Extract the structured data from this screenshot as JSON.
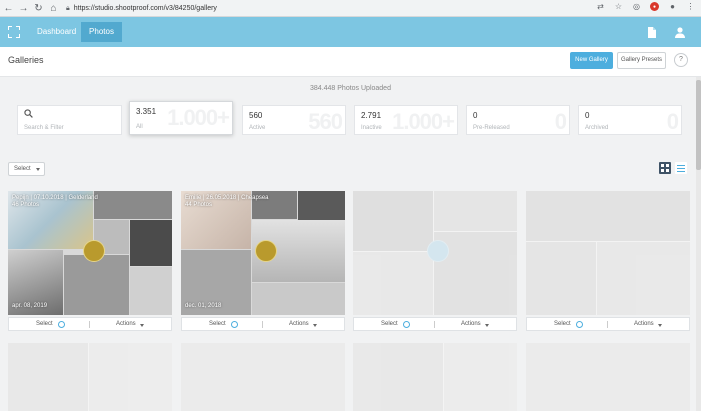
{
  "browser": {
    "url": "https://studio.shootproof.com/v3/84250/gallery",
    "icons": [
      "back-icon",
      "forward-icon",
      "reload-icon",
      "home-icon",
      "lock-icon"
    ]
  },
  "header": {
    "tabs": [
      {
        "label": "Dashboard",
        "active": false
      },
      {
        "label": "Photos",
        "active": true
      }
    ],
    "brand_color": "#7dc6e2",
    "active_tab_color": "#52a9cf"
  },
  "toolbar": {
    "title": "Galleries",
    "new_gallery_label": "New Gallery",
    "gallery_presets_label": "Gallery Presets",
    "help_label": "?"
  },
  "summary": {
    "text": "384.448 Photos Uploaded"
  },
  "stats": {
    "search": {
      "label": "Search & Filter",
      "icon": "search-icon"
    },
    "all": {
      "value": "3.351",
      "label": "All",
      "ghost": "1.000+"
    },
    "active": {
      "value": "560",
      "label": "Active",
      "ghost": "560"
    },
    "inactive": {
      "value": "2.791",
      "label": "Inactive",
      "ghost": "1.000+"
    },
    "pre_released": {
      "value": "0",
      "label": "Pre-Released",
      "ghost": "0"
    },
    "archived": {
      "value": "0",
      "label": "Archived",
      "ghost": "0"
    }
  },
  "filter": {
    "select_label": "Select"
  },
  "galleries": [
    {
      "title": "Pepijn | 07.10.2018 | Gelderland",
      "count": "46 Photos",
      "date": "apr. 08, 2019",
      "select_label": "Select",
      "actions_label": "Actions"
    },
    {
      "title": "Emilie | 26.05.2018 | Cheapsea",
      "count": "44 Photos",
      "date": "dec. 01, 2018",
      "select_label": "Select",
      "actions_label": "Actions"
    },
    {
      "title": "",
      "count": "",
      "date": "",
      "select_label": "Select",
      "actions_label": "Actions"
    },
    {
      "title": "",
      "count": "",
      "date": "",
      "select_label": "Select",
      "actions_label": "Actions"
    }
  ]
}
